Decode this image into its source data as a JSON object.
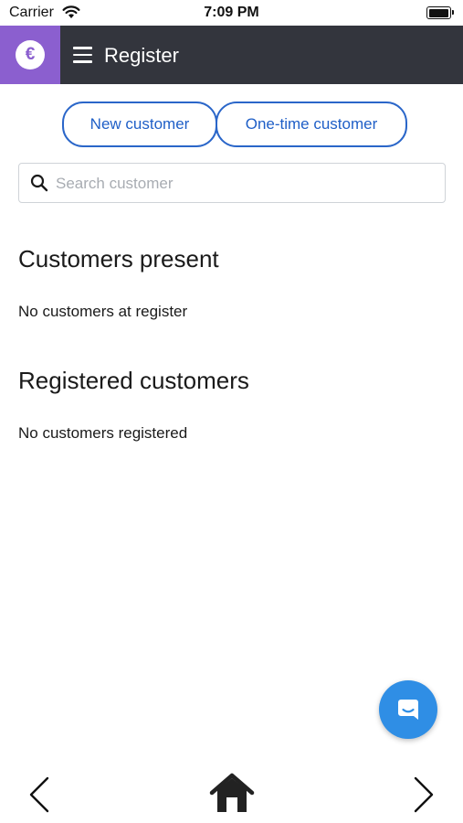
{
  "status_bar": {
    "carrier": "Carrier",
    "time": "7:09 PM",
    "wifi_icon": "wifi-icon",
    "battery_icon": "battery-icon"
  },
  "header": {
    "logo_symbol": "€",
    "logo_icon": "euro-logo-icon",
    "menu_icon": "hamburger-menu-icon",
    "title": "Register",
    "background_color": "#33353d",
    "logo_color": "#8b5fcf"
  },
  "actions": {
    "new_customer_label": "New customer",
    "one_time_customer_label": "One-time customer",
    "accent_color": "#2a66c9"
  },
  "search": {
    "placeholder": "Search customer",
    "value": "",
    "icon": "search-icon"
  },
  "sections": {
    "present": {
      "title": "Customers present",
      "empty_text": "No customers at register"
    },
    "registered": {
      "title": "Registered customers",
      "empty_text": "No customers registered"
    }
  },
  "chat": {
    "icon": "chat-bubble-icon",
    "color": "#2f8ee5"
  },
  "bottom_nav": {
    "back_icon": "chevron-left-icon",
    "home_icon": "home-icon",
    "forward_icon": "chevron-right-icon"
  }
}
